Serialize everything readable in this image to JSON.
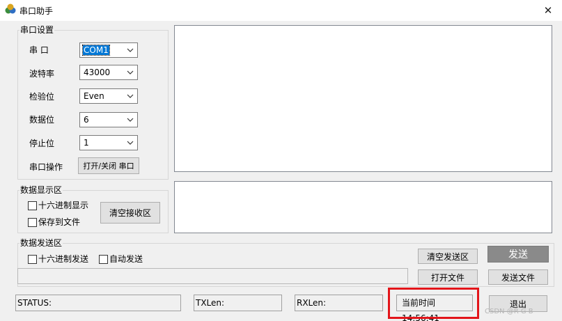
{
  "window": {
    "title": "串口助手",
    "close_glyph": "✕"
  },
  "serial_settings": {
    "group_title": "串口设置",
    "port": {
      "label": "串 口",
      "value": "COM1"
    },
    "baud": {
      "label": "波特率",
      "value": "43000"
    },
    "parity": {
      "label": "检验位",
      "value": "Even"
    },
    "databits": {
      "label": "数据位",
      "value": "6"
    },
    "stopbits": {
      "label": "停止位",
      "value": "1"
    },
    "operation": {
      "label": "串口操作",
      "button": "打开/关闭 串口"
    }
  },
  "display_area": {
    "group_title": "数据显示区",
    "hex_display": "十六进制显示",
    "save_to_file": "保存到文件",
    "clear_receive": "清空接收区"
  },
  "send_area": {
    "group_title": "数据发送区",
    "hex_send": "十六进制发送",
    "auto_send": "自动发送",
    "clear_send": "清空发送区",
    "send": "发送",
    "open_file": "打开文件",
    "send_file": "发送文件"
  },
  "status_bar": {
    "status": "STATUS:",
    "txlen": "TXLen:",
    "rxlen": "RXLen:",
    "time": "当前时间 14:56:41",
    "exit": "退出"
  },
  "watermark": "CSDN @R G B",
  "icons": {
    "app": "app-icon",
    "close": "close-icon",
    "dropdown": "chevron-down-icon"
  },
  "colors": {
    "highlight": "#e3151a",
    "selection": "#0078d7"
  }
}
